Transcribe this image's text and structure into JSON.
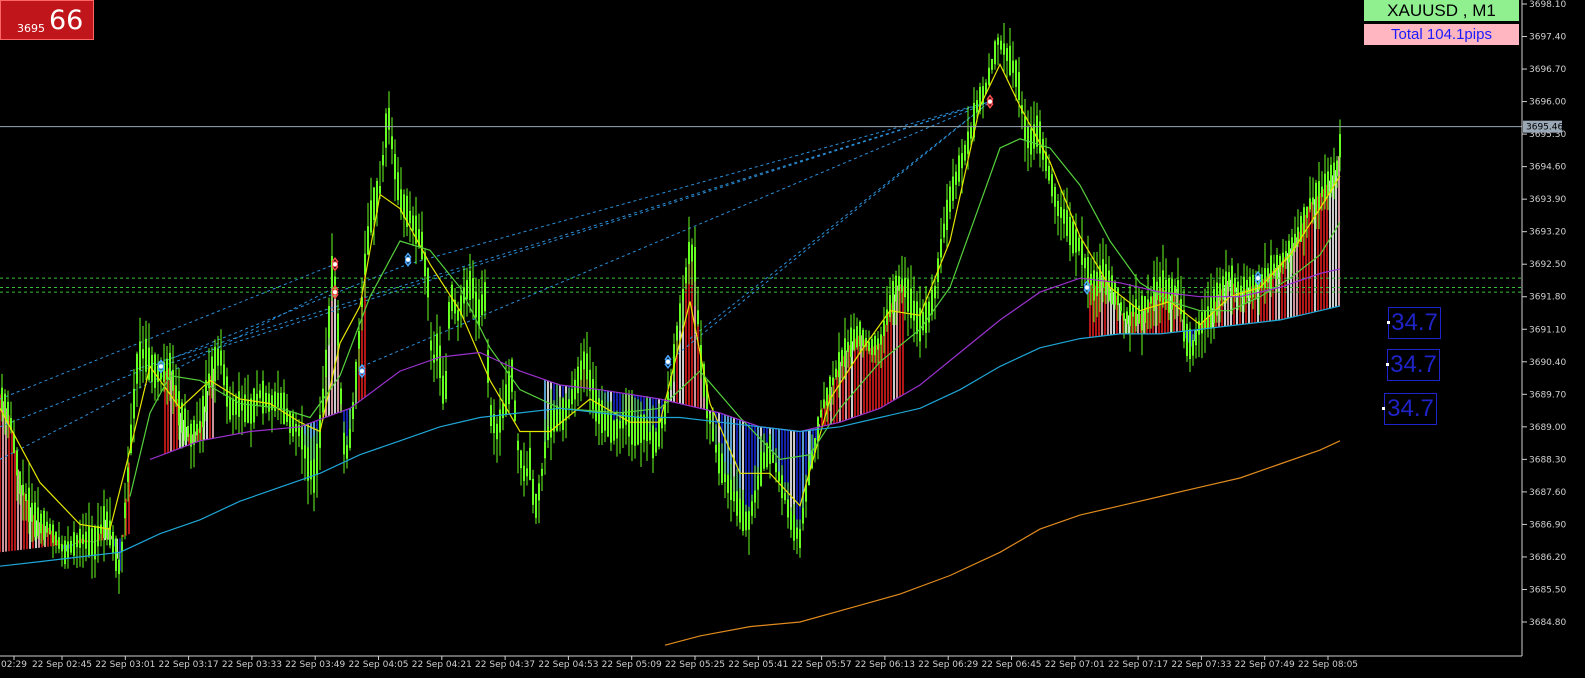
{
  "chart_data": {
    "type": "candlestick",
    "symbol": "XAUUSD , M1",
    "summary_label": "Total  104.1pips",
    "badge": {
      "small": "3695",
      "big": "66"
    },
    "current_price": 3695.46,
    "current_price_label": "3695.46",
    "ylim": [
      3684.2,
      3698.3
    ],
    "y_ticks": [
      "3698.10",
      "3697.40",
      "3696.70",
      "3696.00",
      "3695.30",
      "3694.60",
      "3693.90",
      "3693.20",
      "3692.50",
      "3691.80",
      "3691.10",
      "3690.40",
      "3689.70",
      "3689.00",
      "3688.30",
      "3687.60",
      "3686.90",
      "3686.20",
      "3685.50",
      "3684.80"
    ],
    "x_tick_labels": [
      "02:29",
      "22 Sep 02:45",
      "22 Sep 03:01",
      "22 Sep 03:17",
      "22 Sep 03:33",
      "22 Sep 03:49",
      "22 Sep 04:05",
      "22 Sep 04:21",
      "22 Sep 04:37",
      "22 Sep 04:53",
      "22 Sep 05:09",
      "22 Sep 05:25",
      "22 Sep 05:41",
      "22 Sep 05:57",
      "22 Sep 06:13",
      "22 Sep 06:29",
      "22 Sep 06:45",
      "22 Sep 07:01",
      "22 Sep 07:17",
      "22 Sep 07:33",
      "22 Sep 07:49",
      "22 Sep 08:05"
    ],
    "price_path": [
      [
        0,
        3689.7
      ],
      [
        10,
        3689.2
      ],
      [
        20,
        3687.8
      ],
      [
        35,
        3687.0
      ],
      [
        50,
        3686.8
      ],
      [
        65,
        3686.3
      ],
      [
        80,
        3686.6
      ],
      [
        95,
        3686.5
      ],
      [
        105,
        3687.0
      ],
      [
        112,
        3686.6
      ],
      [
        120,
        3685.9
      ],
      [
        125,
        3687.2
      ],
      [
        132,
        3689.0
      ],
      [
        138,
        3690.5
      ],
      [
        145,
        3690.6
      ],
      [
        150,
        3690.3
      ],
      [
        160,
        3690.1
      ],
      [
        170,
        3690.3
      ],
      [
        180,
        3689.3
      ],
      [
        190,
        3688.8
      ],
      [
        200,
        3689.0
      ],
      [
        210,
        3690.1
      ],
      [
        220,
        3690.6
      ],
      [
        230,
        3689.4
      ],
      [
        240,
        3689.5
      ],
      [
        250,
        3689.3
      ],
      [
        260,
        3689.7
      ],
      [
        270,
        3689.5
      ],
      [
        280,
        3689.6
      ],
      [
        290,
        3689.1
      ],
      [
        300,
        3688.9
      ],
      [
        308,
        3688.2
      ],
      [
        315,
        3687.9
      ],
      [
        322,
        3689.3
      ],
      [
        328,
        3690.9
      ],
      [
        333,
        3692.7
      ],
      [
        338,
        3691.1
      ],
      [
        343,
        3688.7
      ],
      [
        348,
        3688.4
      ],
      [
        352,
        3689.1
      ],
      [
        358,
        3690.6
      ],
      [
        365,
        3692.5
      ],
      [
        372,
        3693.7
      ],
      [
        380,
        3694.1
      ],
      [
        388,
        3695.8
      ],
      [
        395,
        3694.6
      ],
      [
        400,
        3693.9
      ],
      [
        408,
        3693.6
      ],
      [
        415,
        3693.3
      ],
      [
        422,
        3692.9
      ],
      [
        428,
        3692.1
      ],
      [
        432,
        3690.3
      ],
      [
        438,
        3690.8
      ],
      [
        445,
        3689.4
      ],
      [
        450,
        3691.9
      ],
      [
        458,
        3691.4
      ],
      [
        465,
        3691.9
      ],
      [
        472,
        3692.1
      ],
      [
        478,
        3691.4
      ],
      [
        485,
        3691.8
      ],
      [
        490,
        3689.3
      ],
      [
        497,
        3688.9
      ],
      [
        505,
        3689.5
      ],
      [
        512,
        3690.1
      ],
      [
        518,
        3688.6
      ],
      [
        525,
        3687.9
      ],
      [
        530,
        3688.2
      ],
      [
        535,
        3687.2
      ],
      [
        540,
        3687.7
      ],
      [
        545,
        3688.5
      ],
      [
        550,
        3689.1
      ],
      [
        558,
        3689.2
      ],
      [
        565,
        3689.3
      ],
      [
        575,
        3689.8
      ],
      [
        585,
        3690.5
      ],
      [
        595,
        3689.5
      ],
      [
        605,
        3689.1
      ],
      [
        615,
        3688.9
      ],
      [
        625,
        3689.2
      ],
      [
        635,
        3688.9
      ],
      [
        645,
        3689.0
      ],
      [
        655,
        3688.6
      ],
      [
        665,
        3689.3
      ],
      [
        672,
        3690.1
      ],
      [
        678,
        3691.2
      ],
      [
        685,
        3692.1
      ],
      [
        690,
        3692.9
      ],
      [
        695,
        3692.5
      ],
      [
        700,
        3690.6
      ],
      [
        708,
        3689.4
      ],
      [
        715,
        3688.6
      ],
      [
        725,
        3687.9
      ],
      [
        732,
        3687.6
      ],
      [
        740,
        3687.2
      ],
      [
        748,
        3686.9
      ],
      [
        755,
        3687.5
      ],
      [
        762,
        3688.2
      ],
      [
        770,
        3688.5
      ],
      [
        778,
        3688.0
      ],
      [
        785,
        3687.5
      ],
      [
        792,
        3686.9
      ],
      [
        800,
        3686.6
      ],
      [
        808,
        3687.9
      ],
      [
        815,
        3688.6
      ],
      [
        822,
        3689.4
      ],
      [
        830,
        3689.8
      ],
      [
        840,
        3690.4
      ],
      [
        850,
        3690.8
      ],
      [
        860,
        3691.0
      ],
      [
        870,
        3690.7
      ],
      [
        880,
        3690.8
      ],
      [
        890,
        3691.6
      ],
      [
        898,
        3692.1
      ],
      [
        905,
        3692.0
      ],
      [
        912,
        3691.6
      ],
      [
        920,
        3691.2
      ],
      [
        928,
        3691.4
      ],
      [
        935,
        3691.9
      ],
      [
        942,
        3693.0
      ],
      [
        950,
        3693.9
      ],
      [
        958,
        3694.5
      ],
      [
        965,
        3694.9
      ],
      [
        972,
        3695.4
      ],
      [
        978,
        3696.0
      ],
      [
        985,
        3696.2
      ],
      [
        992,
        3696.8
      ],
      [
        998,
        3697.3
      ],
      [
        1005,
        3697.1
      ],
      [
        1012,
        3696.8
      ],
      [
        1018,
        3696.5
      ],
      [
        1024,
        3695.5
      ],
      [
        1030,
        3695.1
      ],
      [
        1038,
        3695.4
      ],
      [
        1045,
        3694.8
      ],
      [
        1052,
        3694.2
      ],
      [
        1058,
        3693.7
      ],
      [
        1065,
        3693.5
      ],
      [
        1072,
        3693.1
      ],
      [
        1080,
        3692.9
      ],
      [
        1088,
        3692.3
      ],
      [
        1095,
        3692.0
      ],
      [
        1103,
        3692.3
      ],
      [
        1110,
        3692.0
      ],
      [
        1118,
        3691.8
      ],
      [
        1125,
        3691.3
      ],
      [
        1133,
        3691.5
      ],
      [
        1140,
        3691.4
      ],
      [
        1148,
        3691.6
      ],
      [
        1155,
        3691.9
      ],
      [
        1163,
        3692.0
      ],
      [
        1170,
        3691.8
      ],
      [
        1178,
        3692.0
      ],
      [
        1186,
        3690.9
      ],
      [
        1193,
        3690.7
      ],
      [
        1200,
        3691.2
      ],
      [
        1210,
        3691.4
      ],
      [
        1220,
        3691.9
      ],
      [
        1230,
        3692.2
      ],
      [
        1240,
        3691.9
      ],
      [
        1250,
        3692.0
      ],
      [
        1260,
        3692.1
      ],
      [
        1270,
        3692.3
      ],
      [
        1280,
        3692.5
      ],
      [
        1290,
        3692.8
      ],
      [
        1300,
        3693.2
      ],
      [
        1310,
        3693.8
      ],
      [
        1320,
        3694.0
      ],
      [
        1330,
        3694.3
      ],
      [
        1338,
        3694.6
      ],
      [
        1342,
        3695.5
      ]
    ],
    "moving_averages": [
      {
        "color": "#e6e600",
        "points": [
          [
            0,
            3689.4
          ],
          [
            40,
            3687.8
          ],
          [
            80,
            3686.9
          ],
          [
            110,
            3686.8
          ],
          [
            130,
            3688.5
          ],
          [
            150,
            3690.3
          ],
          [
            180,
            3689.4
          ],
          [
            210,
            3690.0
          ],
          [
            240,
            3689.6
          ],
          [
            270,
            3689.5
          ],
          [
            300,
            3689.1
          ],
          [
            320,
            3688.9
          ],
          [
            340,
            3690.8
          ],
          [
            360,
            3691.6
          ],
          [
            380,
            3694.0
          ],
          [
            400,
            3693.7
          ],
          [
            430,
            3692.5
          ],
          [
            460,
            3691.5
          ],
          [
            490,
            3690.0
          ],
          [
            520,
            3688.9
          ],
          [
            550,
            3688.9
          ],
          [
            590,
            3689.6
          ],
          [
            630,
            3689.1
          ],
          [
            660,
            3689.1
          ],
          [
            690,
            3691.7
          ],
          [
            710,
            3689.5
          ],
          [
            740,
            3688.0
          ],
          [
            770,
            3688.0
          ],
          [
            800,
            3687.3
          ],
          [
            830,
            3689.6
          ],
          [
            860,
            3690.6
          ],
          [
            890,
            3691.5
          ],
          [
            920,
            3691.4
          ],
          [
            950,
            3693.0
          ],
          [
            980,
            3695.9
          ],
          [
            1000,
            3696.8
          ],
          [
            1020,
            3695.9
          ],
          [
            1050,
            3694.7
          ],
          [
            1080,
            3693.1
          ],
          [
            1110,
            3692.0
          ],
          [
            1140,
            3691.5
          ],
          [
            1170,
            3691.7
          ],
          [
            1200,
            3691.2
          ],
          [
            1230,
            3691.8
          ],
          [
            1260,
            3692.0
          ],
          [
            1290,
            3692.7
          ],
          [
            1320,
            3693.7
          ],
          [
            1340,
            3694.4
          ]
        ]
      },
      {
        "color": "#55d13c",
        "points": [
          [
            130,
            3687.5
          ],
          [
            150,
            3689.3
          ],
          [
            170,
            3690.1
          ],
          [
            200,
            3690.0
          ],
          [
            240,
            3689.5
          ],
          [
            280,
            3689.4
          ],
          [
            310,
            3689.2
          ],
          [
            340,
            3690.1
          ],
          [
            370,
            3691.8
          ],
          [
            400,
            3693.0
          ],
          [
            430,
            3692.8
          ],
          [
            460,
            3692.0
          ],
          [
            490,
            3690.7
          ],
          [
            520,
            3689.8
          ],
          [
            560,
            3689.4
          ],
          [
            620,
            3689.3
          ],
          [
            660,
            3689.4
          ],
          [
            700,
            3690.2
          ],
          [
            740,
            3689.2
          ],
          [
            780,
            3688.3
          ],
          [
            810,
            3688.4
          ],
          [
            840,
            3689.4
          ],
          [
            880,
            3690.4
          ],
          [
            920,
            3691.1
          ],
          [
            950,
            3692.0
          ],
          [
            980,
            3693.8
          ],
          [
            1000,
            3695.0
          ],
          [
            1020,
            3695.2
          ],
          [
            1050,
            3695.0
          ],
          [
            1080,
            3694.2
          ],
          [
            1110,
            3693.0
          ],
          [
            1140,
            3692.1
          ],
          [
            1170,
            3691.7
          ],
          [
            1200,
            3691.5
          ],
          [
            1230,
            3691.5
          ],
          [
            1260,
            3691.8
          ],
          [
            1290,
            3692.2
          ],
          [
            1320,
            3692.7
          ],
          [
            1340,
            3693.4
          ]
        ]
      },
      {
        "color": "#9932cc",
        "points": [
          [
            150,
            3688.3
          ],
          [
            200,
            3688.7
          ],
          [
            250,
            3688.9
          ],
          [
            300,
            3689.0
          ],
          [
            350,
            3689.4
          ],
          [
            400,
            3690.2
          ],
          [
            440,
            3690.5
          ],
          [
            480,
            3690.6
          ],
          [
            520,
            3690.2
          ],
          [
            560,
            3689.9
          ],
          [
            600,
            3689.8
          ],
          [
            660,
            3689.6
          ],
          [
            720,
            3689.3
          ],
          [
            760,
            3689.0
          ],
          [
            800,
            3688.9
          ],
          [
            840,
            3689.1
          ],
          [
            880,
            3689.4
          ],
          [
            920,
            3689.9
          ],
          [
            960,
            3690.6
          ],
          [
            1000,
            3691.3
          ],
          [
            1040,
            3691.9
          ],
          [
            1080,
            3692.2
          ],
          [
            1120,
            3692.1
          ],
          [
            1160,
            3691.9
          ],
          [
            1200,
            3691.8
          ],
          [
            1240,
            3691.8
          ],
          [
            1280,
            3692.0
          ],
          [
            1320,
            3692.3
          ],
          [
            1340,
            3692.4
          ]
        ]
      },
      {
        "color": "#1fa6d6",
        "points": [
          [
            0,
            3686.0
          ],
          [
            40,
            3686.1
          ],
          [
            80,
            3686.2
          ],
          [
            120,
            3686.3
          ],
          [
            160,
            3686.7
          ],
          [
            200,
            3687.0
          ],
          [
            240,
            3687.4
          ],
          [
            280,
            3687.7
          ],
          [
            320,
            3688.0
          ],
          [
            360,
            3688.4
          ],
          [
            400,
            3688.7
          ],
          [
            440,
            3689.0
          ],
          [
            480,
            3689.2
          ],
          [
            520,
            3689.3
          ],
          [
            560,
            3689.4
          ],
          [
            600,
            3689.3
          ],
          [
            640,
            3689.2
          ],
          [
            680,
            3689.2
          ],
          [
            720,
            3689.1
          ],
          [
            760,
            3689.0
          ],
          [
            800,
            3688.9
          ],
          [
            840,
            3689.0
          ],
          [
            880,
            3689.2
          ],
          [
            920,
            3689.4
          ],
          [
            960,
            3689.8
          ],
          [
            1000,
            3690.3
          ],
          [
            1040,
            3690.7
          ],
          [
            1080,
            3690.9
          ],
          [
            1120,
            3691.0
          ],
          [
            1160,
            3691.0
          ],
          [
            1200,
            3691.1
          ],
          [
            1240,
            3691.2
          ],
          [
            1280,
            3691.3
          ],
          [
            1320,
            3691.5
          ],
          [
            1340,
            3691.6
          ]
        ]
      },
      {
        "color": "#e08a1e",
        "points": [
          [
            665,
            3684.3
          ],
          [
            700,
            3684.5
          ],
          [
            750,
            3684.7
          ],
          [
            800,
            3684.8
          ],
          [
            850,
            3685.1
          ],
          [
            900,
            3685.4
          ],
          [
            950,
            3685.8
          ],
          [
            1000,
            3686.3
          ],
          [
            1040,
            3686.8
          ],
          [
            1080,
            3687.1
          ],
          [
            1120,
            3687.3
          ],
          [
            1160,
            3687.5
          ],
          [
            1200,
            3687.7
          ],
          [
            1240,
            3687.9
          ],
          [
            1280,
            3688.2
          ],
          [
            1320,
            3688.5
          ],
          [
            1340,
            3688.7
          ]
        ]
      }
    ],
    "horizontal_levels": [
      3692.2,
      3692.0,
      3691.9
    ],
    "labels": [
      {
        "text": "34.7"
      },
      {
        "text": "34.7"
      },
      {
        "text": "34.7"
      }
    ]
  }
}
